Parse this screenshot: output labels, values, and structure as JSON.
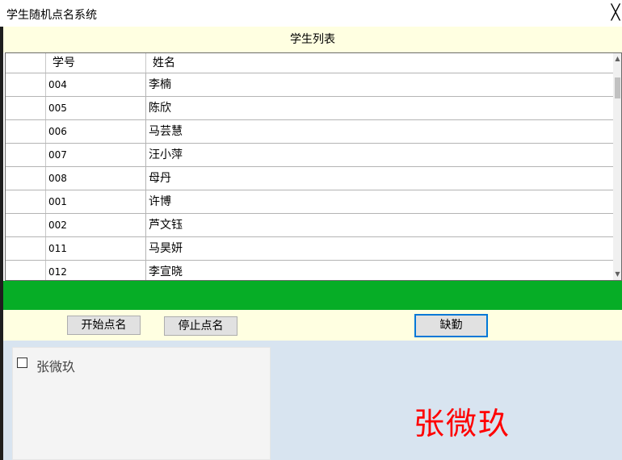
{
  "window": {
    "title": "学生随机点名系统",
    "close_glyph": "╳"
  },
  "list_header": "学生列表",
  "grid": {
    "columns": [
      "学号",
      "姓名"
    ],
    "rows": [
      {
        "id": "004",
        "name": "李楠"
      },
      {
        "id": "005",
        "name": "陈欣"
      },
      {
        "id": "006",
        "name": "马芸慧"
      },
      {
        "id": "007",
        "name": "汪小萍"
      },
      {
        "id": "008",
        "name": "母丹"
      },
      {
        "id": "001",
        "name": "许博"
      },
      {
        "id": "002",
        "name": "芦文钰"
      },
      {
        "id": "011",
        "name": "马昊妍"
      },
      {
        "id": "012",
        "name": "李宣晓"
      }
    ],
    "scroll_up_glyph": "▲",
    "scroll_down_glyph": "▼"
  },
  "buttons": {
    "start": "开始点名",
    "stop": "停止点名",
    "absent": "缺勤"
  },
  "absent_list": {
    "items": [
      {
        "label": "张微玖",
        "checked": false
      }
    ]
  },
  "selected_name": "张微玖",
  "colors": {
    "green_bar": "#06ad26",
    "panel_yellow": "#ffffe1",
    "bottom_panel": "#d8e4f0",
    "name_red": "#ff0000",
    "focus_blue": "#0078d7"
  }
}
